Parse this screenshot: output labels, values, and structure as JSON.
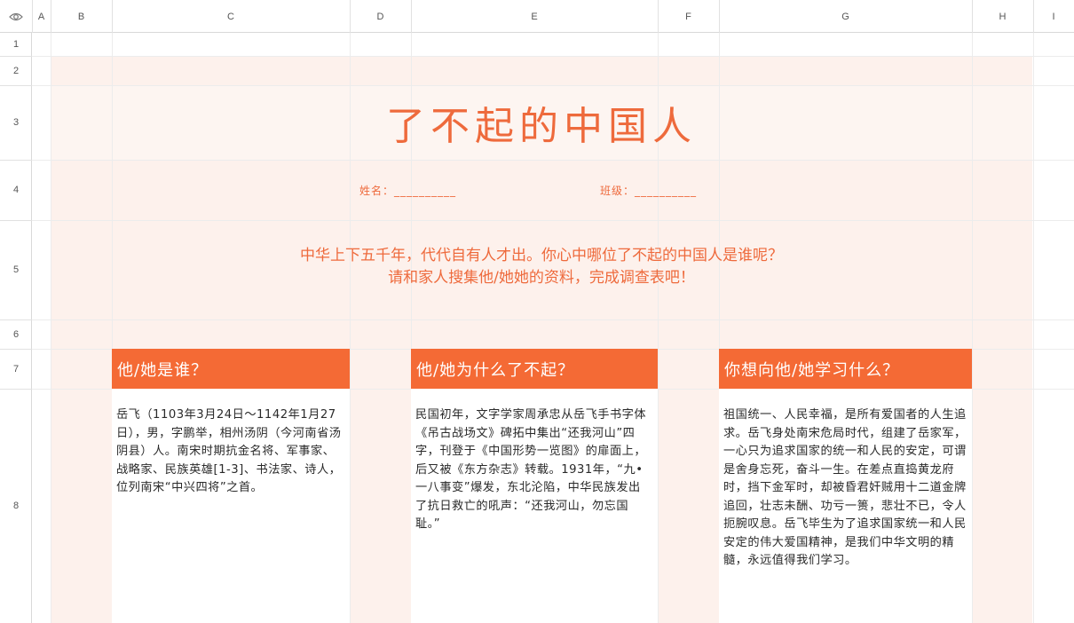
{
  "columns": [
    "A",
    "B",
    "C",
    "D",
    "E",
    "F",
    "G",
    "H",
    "I"
  ],
  "rows": [
    "1",
    "2",
    "3",
    "4",
    "5",
    "6",
    "7",
    "8"
  ],
  "sheet": {
    "title": "了不起的中国人",
    "name_label": "姓名：__________",
    "class_label": "班级：__________",
    "intro_line1": "中华上下五千年，代代自有人才出。你心中哪位了不起的中国人是谁呢？",
    "intro_line2": "请和家人搜集他/她她的资料，完成调查表吧！"
  },
  "cards": [
    {
      "header": "他/她是谁？",
      "body": "岳飞（1103年3月24日～1142年1月27日），男，字鹏举，相州汤阴（今河南省汤阴县）人。南宋时期抗金名将、军事家、战略家、民族英雄[1-3]、书法家、诗人，位列南宋“中兴四将”之首。"
    },
    {
      "header": "他/她为什么了不起？",
      "body": "民国初年，文字学家周承忠从岳飞手书字体《吊古战场文》碑拓中集出“还我河山”四字，刊登于《中国形势一览图》的扉面上，后又被《东方杂志》转载。1931年，“九•一八事变”爆发，东北沦陷，中华民族发出了抗日救亡的吼声：“还我河山，勿忘国耻。”"
    },
    {
      "header": "你想向他/她学习什么？",
      "body": "祖国统一、人民幸福，是所有爱国者的人生追求。岳飞身处南宋危局时代，组建了岳家军，一心只为追求国家的统一和人民的安定，可谓是舍身忘死，奋斗一生。在差点直捣黄龙府时，挡下金军时，却被昏君奸贼用十二道金牌追回，壮志未酬、功亏一篑，悲壮不已，令人扼腕叹息。岳飞毕生为了追求国家统一和人民安定的伟大爱国精神，是我们中华文明的精髓，永远值得我们学习。"
    }
  ]
}
